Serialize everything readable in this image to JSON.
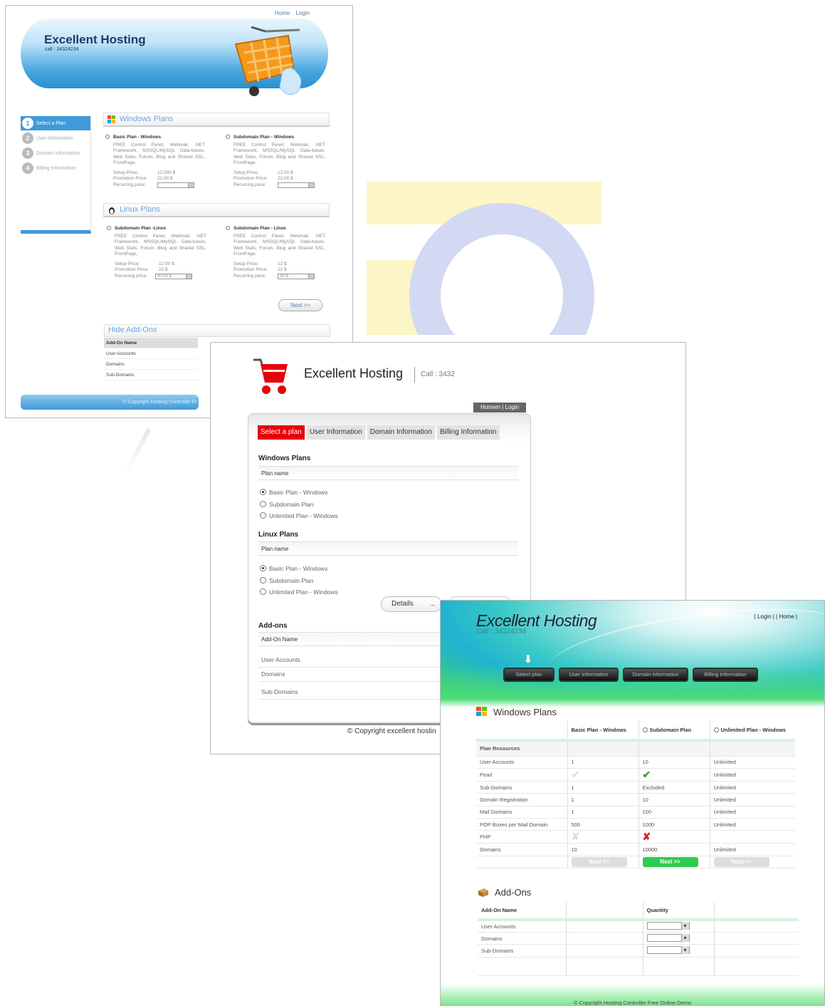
{
  "s1": {
    "top_links": [
      "Home",
      "Login"
    ],
    "title": "Excellent Hosting",
    "call": "call : 34324234",
    "steps": [
      {
        "num": "1",
        "label": "Select a Plan"
      },
      {
        "num": "2",
        "label": "User Information"
      },
      {
        "num": "3",
        "label": "Domain Information"
      },
      {
        "num": "4",
        "label": "Billing Information"
      }
    ],
    "windows_section": "Windows Plans",
    "linux_section": "Linux Plans",
    "plans": [
      {
        "name": "Basic Plan - Windows",
        "desc": "FREE Control Panel, Webmail, .NET Framework, MSSQL/MySQL Data-bases, Web Stats, Forum, Blog and Shared SSL, FrontPage,",
        "setup_label": "Setup Price:",
        "setup": "12.000 $",
        "promo_label": "Promotion Price:",
        "promo": "22.00 $",
        "recur_label": "Recurring price:",
        "recur": ""
      },
      {
        "name": "Subdomain Plan - Windows",
        "desc": "FREE Control Panel, Webmail, .NET Framework, MSSQL/MySQL Data-bases, Web Stats, Forum, Blog and Shared SSL, FrontPage,",
        "setup_label": "Setup Price:",
        "setup": "12.00 $",
        "promo_label": "Promotion Price:",
        "promo": "22.00 $",
        "recur_label": "Recurring price:",
        "recur": ""
      },
      {
        "name": "Subdomain Plan -Linux",
        "desc": "FREE Control Panel, Webmail, .NET Framework, MSSQL/MySQL Data-bases, Web Stats, Forum, Blog and Shared SSL, FrontPage,",
        "setup_label": "Setup Price:",
        "setup": "12.00 $",
        "promo_label": "Promotion Price:",
        "promo": "22 $",
        "recur_label": "Recurring price:",
        "recur": "30.00 $"
      },
      {
        "name": "Subdomain Plan - Linux",
        "desc": "FREE Control Panel, Webmail, .NET Framework, MSSQL/MySQL Data-bases, Web Stats, Forum, Blog and Shared SSL, FrontPage,",
        "setup_label": "Setup Price:",
        "setup": "12 $",
        "promo_label": "Promotion Price:",
        "promo": "22 $",
        "recur_label": "Recurring price:",
        "recur": "30 $"
      }
    ],
    "next": "Next >>",
    "addons_title": "Hide Add-Ons",
    "addons_header": "Add-On Name",
    "addons": [
      "User Accounts",
      "Domains",
      "Sub-Domains"
    ],
    "footer": "© Copyright Hosting Controller Fr"
  },
  "s2": {
    "title": "Excellent Hosting",
    "call": "Call : 3432",
    "links": "Homem | Login",
    "tabs": [
      "Select a plan",
      "User Information",
      "Domain Information",
      "Billing Information"
    ],
    "windows_title": "Windows Plans",
    "linux_title": "Linux Plans",
    "plan_header": "Plan name",
    "windows_plans": [
      "Basic Plan - Windows",
      "Subdomain Plan",
      "Unlimited Plan - Windows"
    ],
    "linux_plans": [
      "Basic Plan - Windows",
      "Subdomain Plan",
      "Unlimited Plan - Windows"
    ],
    "details": "Details",
    "addons_title": "Add-ons",
    "addons_header": "Add-On Name",
    "addons": [
      "User Accounts",
      "Domains",
      "Sub-Domains"
    ],
    "copyright": "© Copyright excellent hostin"
  },
  "s3": {
    "title": "Excellent Hosting",
    "call": "Call : 34324234",
    "links": "| Login | | Home |",
    "steps": [
      "Select plan",
      "User information",
      "Domain information",
      "Billing information"
    ],
    "windows_title": "Windows Plans",
    "columns": [
      "Basic Plan - Windows",
      "Subdomain Plan",
      "Unlimited Plan - Windows"
    ],
    "group": "Plan Resources",
    "rows": [
      {
        "name": "User Accounts",
        "v": [
          "1",
          "10",
          "Unlimited"
        ]
      },
      {
        "name": "Pearl",
        "v": [
          "",
          "",
          "Unlimited"
        ]
      },
      {
        "name": "Sub-Domains",
        "v": [
          "1",
          "Excluded",
          "Unlimited"
        ]
      },
      {
        "name": "Domain Registration",
        "v": [
          "1",
          "10",
          "Unlimited"
        ]
      },
      {
        "name": "Mail Domains",
        "v": [
          "1",
          "100",
          "Unlimited"
        ]
      },
      {
        "name": "POP Boxes per Mail Domain",
        "v": [
          "500",
          "1000",
          "Unlimited"
        ]
      },
      {
        "name": "PHP",
        "v": [
          "",
          "",
          ""
        ]
      },
      {
        "name": "Domains",
        "v": [
          "10",
          "10000",
          "Unlimited"
        ]
      }
    ],
    "next": "Next >>",
    "addons_title": "Add-Ons",
    "addon_header": "Add-On Name",
    "quantity": "Quantity",
    "addons": [
      "User Accounts",
      "Domains",
      "Sub-Domains"
    ],
    "footer": "© Copyright Hosting Controller Free Online Demo",
    "accent_green": "#2ecc4f"
  }
}
